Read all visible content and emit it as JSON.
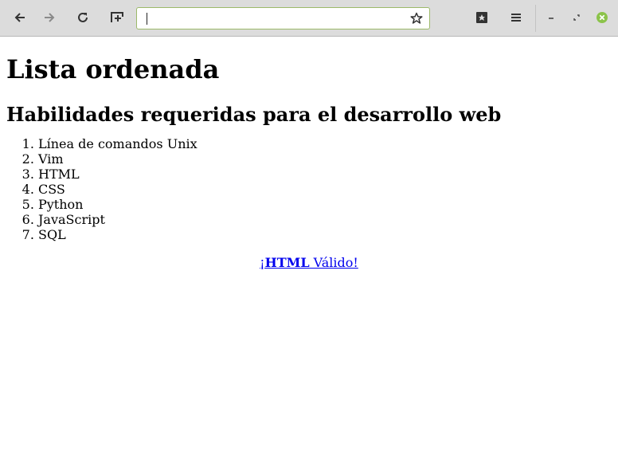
{
  "browser": {
    "nav": {
      "back": "back-arrow-icon",
      "forward": "forward-arrow-icon",
      "reload": "reload-icon",
      "new_tab": "new-tab-icon"
    },
    "url_value": "",
    "bookmark_icon": "star-icon",
    "menu_icons": [
      "library-icon",
      "hamburger-menu-icon"
    ],
    "window_controls": [
      "minimize-icon",
      "restore-icon",
      "close-icon"
    ],
    "colors": {
      "toolbar_bg": "#dcdcdc",
      "urlbar_border": "#9cb96a",
      "close_button": "#8bc34a",
      "link": "#0000ee"
    }
  },
  "page": {
    "title": "Lista ordenada",
    "subtitle": "Habilidades requeridas para el desarrollo web",
    "skills": [
      "Línea de comandos Unix",
      "Vim",
      "HTML",
      "CSS",
      "Python",
      "JavaScript",
      "SQL"
    ],
    "validator": {
      "prefix": "¡",
      "strong": "HTML",
      "suffix": " Válido!"
    }
  }
}
